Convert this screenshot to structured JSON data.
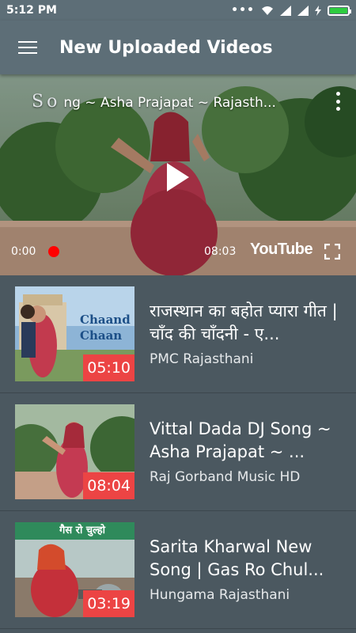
{
  "status_bar": {
    "time": "5:12 PM",
    "icons": [
      "more-dots-icon",
      "wifi-icon",
      "signal-icon",
      "signal-icon",
      "charging-icon",
      "battery-icon"
    ],
    "battery_level": 1.0
  },
  "app_bar": {
    "title": "New Uploaded Videos",
    "menu_icon": "hamburger-menu-icon"
  },
  "player": {
    "title": "ng ~ Asha Prajapat ~ Rajasth...",
    "watermark": "So",
    "current_time": "0:00",
    "total_time": "08:03",
    "logo_text": "YouTube",
    "progress": 0.0
  },
  "videos": [
    {
      "title": "राजस्थान का बहोत प्यारा गीत | चाँद की चाँदनी - ए...",
      "channel": "PMC Rajasthani",
      "duration": "05:10",
      "thumb_text": "Chaand Chaan"
    },
    {
      "title": "Vittal Dada DJ Song ~ Asha Prajapat ~ ...",
      "channel": "Raj Gorband Music HD",
      "duration": "08:04"
    },
    {
      "title": "Sarita Kharwal New Song | Gas Ro Chul...",
      "channel": "Hungama Rajasthani",
      "duration": "03:19",
      "thumb_text": "गैस रो चुल्हो"
    }
  ],
  "colors": {
    "app_bar": "#5d6e77",
    "background": "#4b5860",
    "duration_badge": "#ec4444",
    "progress_dot": "#ff0000",
    "battery": "#2ecc40"
  }
}
